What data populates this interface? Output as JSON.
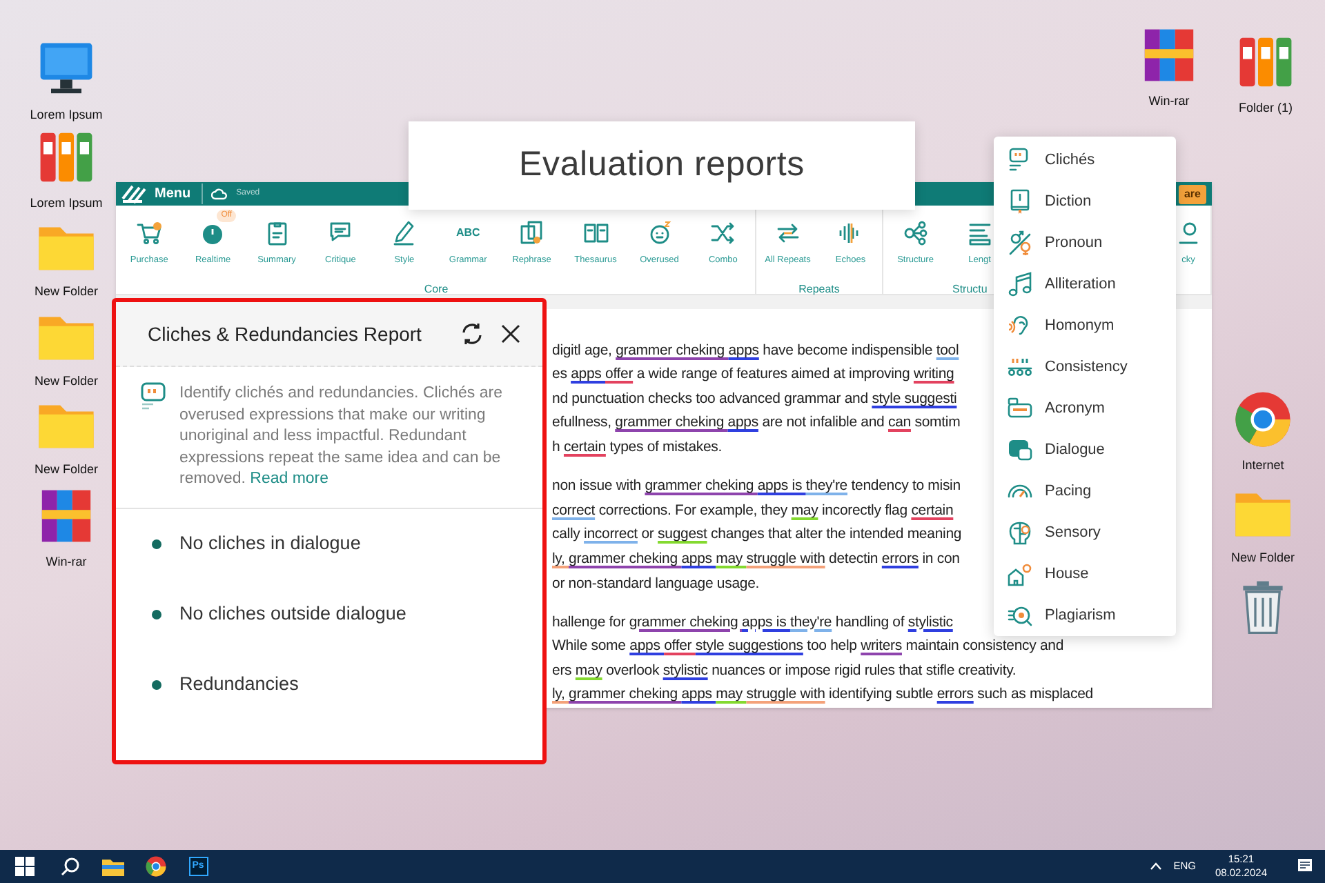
{
  "desktop_icons_left": [
    {
      "kind": "computer",
      "label": "Lorem Ipsum"
    },
    {
      "kind": "binders",
      "label": "Lorem Ipsum"
    },
    {
      "kind": "folder",
      "label": "New Folder"
    },
    {
      "kind": "folder",
      "label": "New Folder"
    },
    {
      "kind": "folder",
      "label": "New Folder"
    },
    {
      "kind": "archive",
      "label": "Win-rar"
    }
  ],
  "desktop_icons_right": [
    {
      "kind": "archive",
      "label": "Win-rar"
    },
    {
      "kind": "binders",
      "label": "Folder (1)"
    },
    {
      "kind": "browser",
      "label": "Internet"
    },
    {
      "kind": "folder",
      "label": "New Folder"
    },
    {
      "kind": "trash"
    }
  ],
  "callout": {
    "title": "Evaluation reports"
  },
  "app": {
    "menu_label": "Menu",
    "save_status": "Saved",
    "share_button": "are",
    "groups": [
      {
        "label": "Core",
        "tools": [
          {
            "label": "Purchase"
          },
          {
            "label": "Realtime",
            "badge": "Off"
          },
          {
            "label": "Summary"
          },
          {
            "label": "Critique"
          },
          {
            "label": "Style"
          },
          {
            "label": "Grammar",
            "icon_text": "ABC"
          },
          {
            "label": "Rephrase"
          },
          {
            "label": "Thesaurus"
          },
          {
            "label": "Overused"
          },
          {
            "label": "Combo"
          }
        ]
      },
      {
        "label": "Repeats",
        "tools": [
          {
            "label": "All Repeats"
          },
          {
            "label": "Echoes"
          }
        ]
      },
      {
        "label": "Structu",
        "tools": [
          {
            "label": "Structure"
          },
          {
            "label": "Lengt"
          }
        ]
      }
    ],
    "trailing_tool": {
      "label": "cky"
    },
    "document": [
      {
        "lines": [
          [
            {
              "text": "digitl age, "
            },
            {
              "text": "grammer cheking ",
              "color": "#8e44ad"
            },
            {
              "text": "apps",
              "color": "#2f3fe0"
            },
            {
              "text": " have become indispensible "
            },
            {
              "text": "tool",
              "color": "#7fb2ea"
            }
          ],
          [
            {
              "text": "es "
            },
            {
              "text": "apps ",
              "color": "#2f3fe0"
            },
            {
              "text": "offer",
              "color": "#e3425f"
            },
            {
              "text": " a wide range of features aimed at improving "
            },
            {
              "text": "writing",
              "color": "#e3425f"
            }
          ],
          [
            {
              "text": "nd punctuation checks too advanced grammar and "
            },
            {
              "text": "style suggesti",
              "color": "#2f3fe0"
            }
          ],
          [
            {
              "text": "efullness, "
            },
            {
              "text": "grammer cheking ",
              "color": "#8e44ad"
            },
            {
              "text": "apps",
              "color": "#2f3fe0"
            },
            {
              "text": " are not infalible and "
            },
            {
              "text": "can",
              "color": "#e3425f"
            },
            {
              "text": " somtim"
            }
          ],
          [
            {
              "text": "h "
            },
            {
              "text": "certain",
              "color": "#e3425f"
            },
            {
              "text": " types of mistakes."
            }
          ]
        ]
      },
      {
        "lines": [
          [
            {
              "text": "non issue with "
            },
            {
              "text": "grammer cheking ",
              "color": "#8e44ad"
            },
            {
              "text": "apps is ",
              "color": "#2f3fe0"
            },
            {
              "text": "they're",
              "color": "#7fb2ea"
            },
            {
              "text": " tendency to misin"
            }
          ],
          [
            {
              "text": "correct",
              "color": "#7fb2ea"
            },
            {
              "text": " corrections. For example, they "
            },
            {
              "text": "may",
              "color": "#84d930"
            },
            {
              "text": " incorectly flag "
            },
            {
              "text": "certain",
              "color": "#e3425f"
            }
          ],
          [
            {
              "text": "cally "
            },
            {
              "text": "incorrect",
              "color": "#7fb2ea"
            },
            {
              "text": " or "
            },
            {
              "text": "suggest",
              "color": "#84d930"
            },
            {
              "text": " changes that alter the intended meaning"
            }
          ],
          [
            {
              "text": "ly, ",
              "color": "#f4a27a"
            },
            {
              "text": "grammer cheking ",
              "color": "#8e44ad"
            },
            {
              "text": "apps ",
              "color": "#2f3fe0"
            },
            {
              "text": "may ",
              "color": "#84d930"
            },
            {
              "text": "struggle with",
              "color": "#f4a27a"
            },
            {
              "text": " detectin "
            },
            {
              "text": "errors",
              "color": "#2f3fe0"
            },
            {
              "text": " in con"
            }
          ],
          [
            {
              "text": "or non-standard language usage."
            }
          ]
        ]
      },
      {
        "lines": [
          [
            {
              "text": "hallenge for "
            },
            {
              "text": "grammer cheking ",
              "color": "#8e44ad"
            },
            {
              "text": "apps is ",
              "color": "#2f3fe0"
            },
            {
              "text": "they're",
              "color": "#7fb2ea"
            },
            {
              "text": " handling of "
            },
            {
              "text": "stylistic",
              "color": "#2f3fe0"
            }
          ],
          [
            {
              "text": "While some "
            },
            {
              "text": "apps ",
              "color": "#2f3fe0"
            },
            {
              "text": "offer ",
              "color": "#e3425f"
            },
            {
              "text": "style suggestions",
              "color": "#2f3fe0"
            },
            {
              "text": " too help "
            },
            {
              "text": "writers",
              "color": "#8e44ad"
            },
            {
              "text": " maintain consistency and"
            }
          ],
          [
            {
              "text": "ers "
            },
            {
              "text": "may",
              "color": "#84d930"
            },
            {
              "text": " overlook "
            },
            {
              "text": "stylistic",
              "color": "#2f3fe0"
            },
            {
              "text": " nuances or impose rigid rules that stifle creativity."
            }
          ],
          [
            {
              "text": "ly, ",
              "color": "#f4a27a"
            },
            {
              "text": "grammer cheking ",
              "color": "#8e44ad"
            },
            {
              "text": "apps ",
              "color": "#2f3fe0"
            },
            {
              "text": "may ",
              "color": "#84d930"
            },
            {
              "text": "struggle with",
              "color": "#f4a27a"
            },
            {
              "text": " identifying subtle "
            },
            {
              "text": "errors",
              "color": "#2f3fe0"
            },
            {
              "text": " such as misplaced"
            }
          ]
        ]
      }
    ]
  },
  "report_panel": {
    "title": "Cliches & Redundancies Report",
    "description": "Identify clichés and redundancies. Clichés are overused expressions that make our writing unoriginal and less impactful. Redundant expressions repeat the same idea and can be removed.",
    "read_more": "Read more",
    "items": [
      "No cliches in dialogue",
      "No cliches outside dialogue",
      "Redundancies"
    ]
  },
  "reports_menu": [
    "Clichés",
    "Diction",
    "Pronoun",
    "Alliteration",
    "Homonym",
    "Consistency",
    "Acronym",
    "Dialogue",
    "Pacing",
    "Sensory",
    "House",
    "Plagiarism"
  ],
  "taskbar": {
    "apps": [
      {
        "kind": "explorer"
      },
      {
        "kind": "browser"
      },
      {
        "kind": "photoshop",
        "label": "Ps"
      }
    ],
    "language": "ENG",
    "time": "15:21",
    "date": "08.02.2024"
  }
}
